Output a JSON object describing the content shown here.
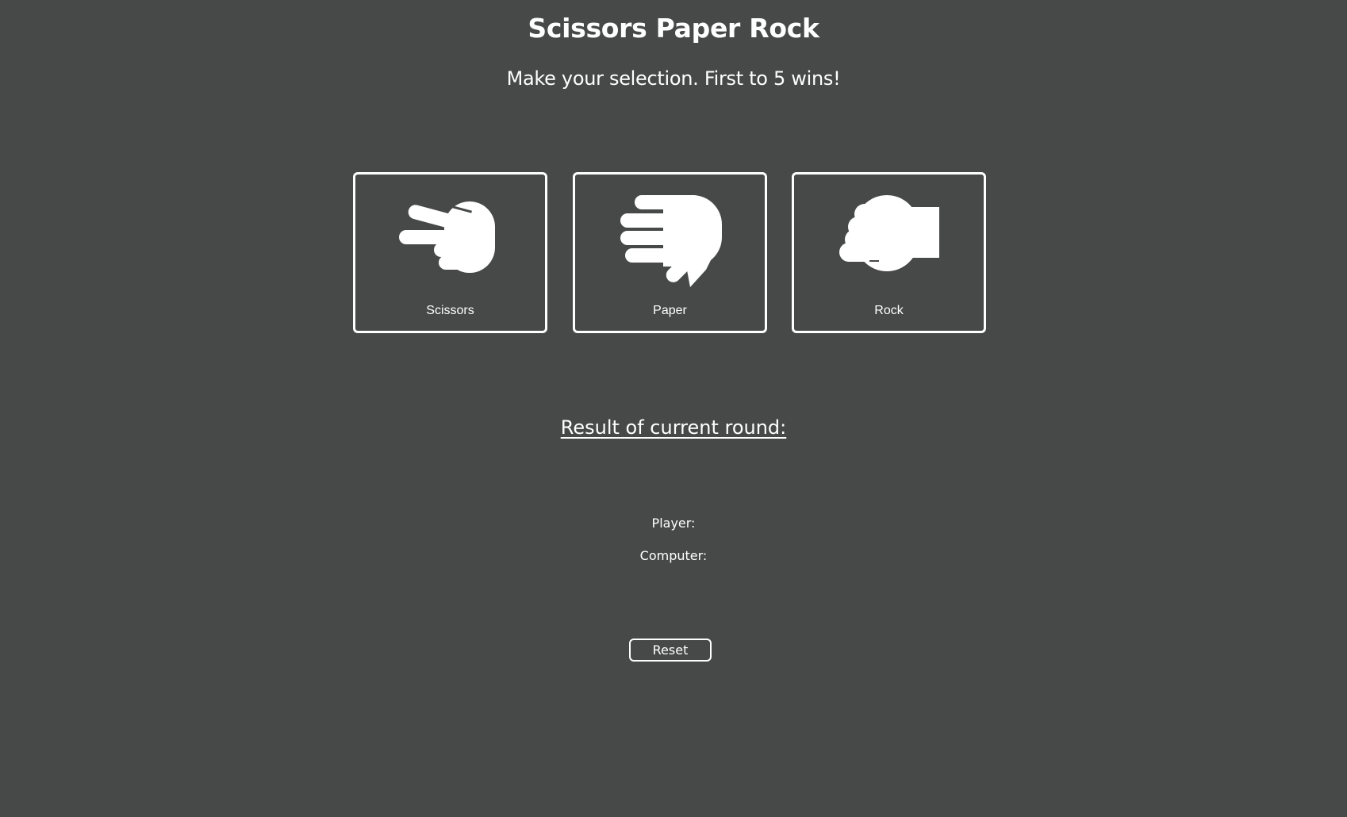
{
  "header": {
    "title": "Scissors Paper Rock",
    "subtitle": "Make your selection. First to 5 wins!"
  },
  "choices": [
    {
      "label": "Scissors",
      "icon": "hand-scissors-icon"
    },
    {
      "label": "Paper",
      "icon": "hand-paper-icon"
    },
    {
      "label": "Rock",
      "icon": "hand-rock-icon"
    }
  ],
  "round": {
    "heading": "Result of current round:",
    "result": ""
  },
  "score": {
    "player_label": "Player:",
    "player_value": "",
    "computer_label": "Computer:",
    "computer_value": ""
  },
  "controls": {
    "reset_label": "Reset"
  },
  "colors": {
    "background": "#474948",
    "foreground": "#ffffff"
  }
}
